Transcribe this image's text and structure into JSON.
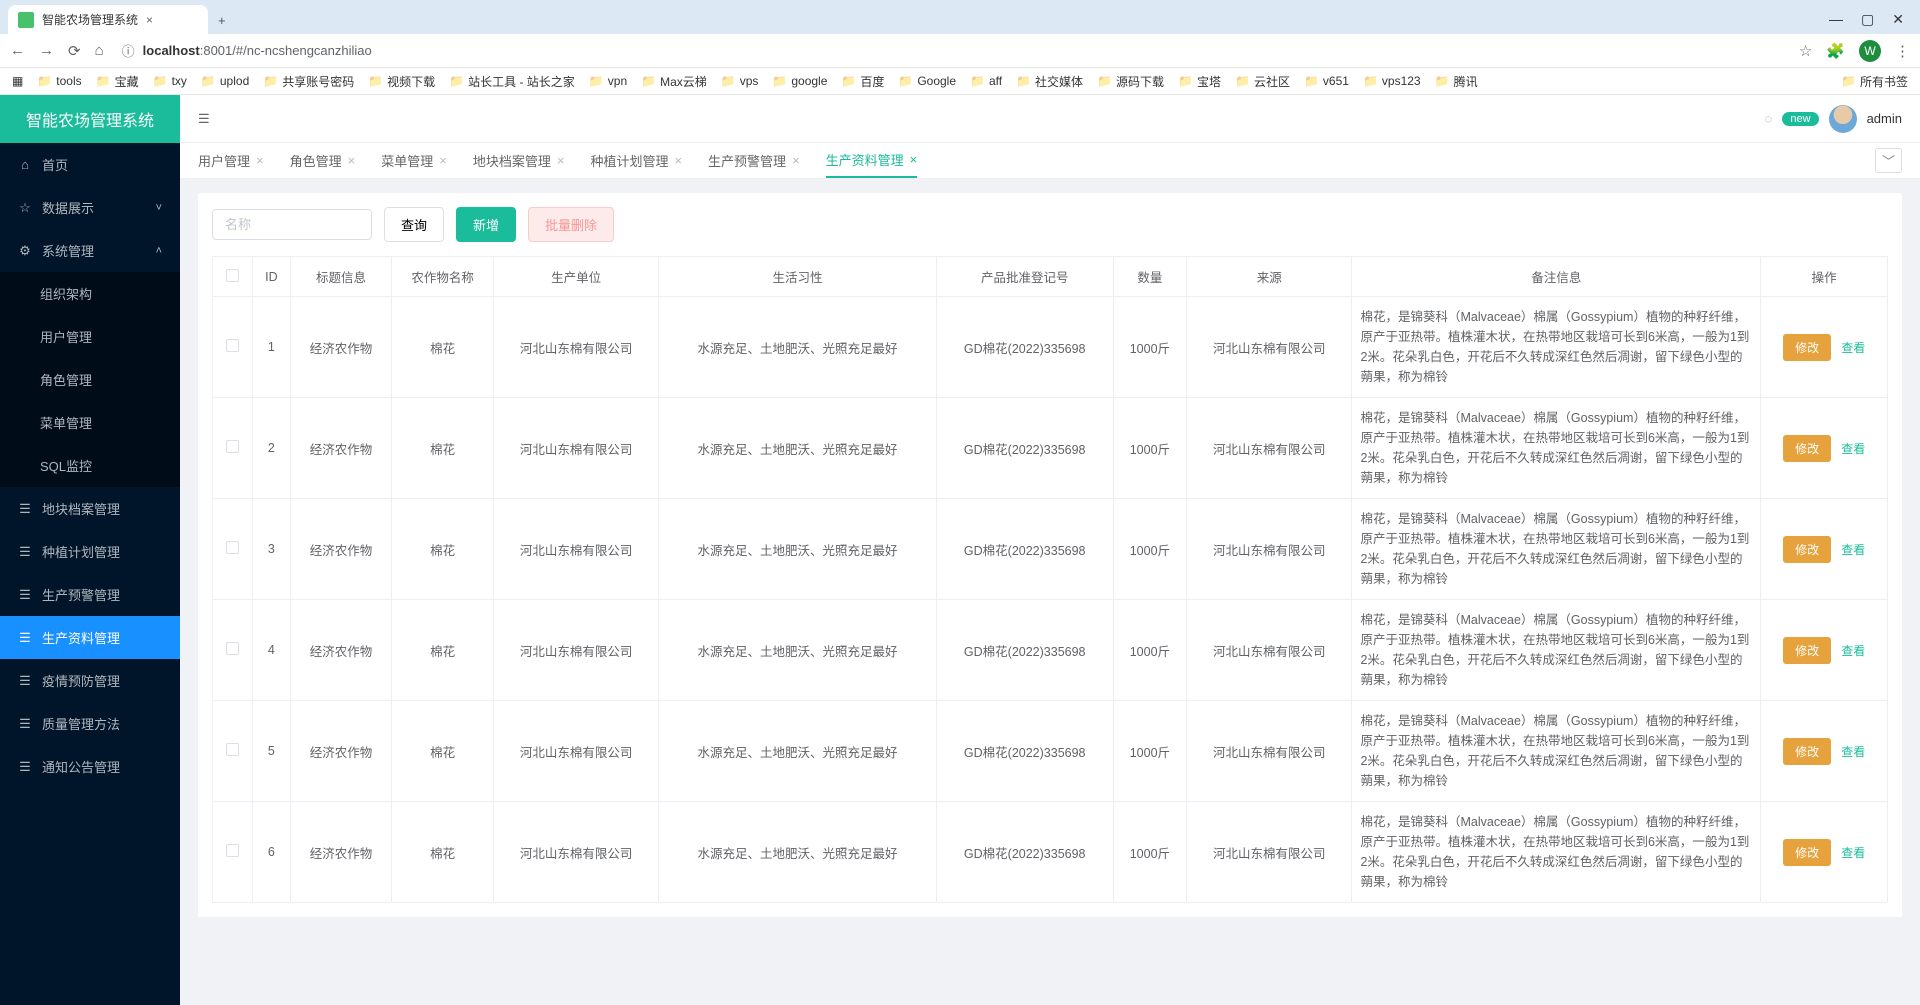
{
  "browser": {
    "tab_title": "智能农场管理系统",
    "new_tab": "+",
    "win_min": "—",
    "win_max": "▢",
    "win_close": "✕",
    "url_host": "localhost",
    "url_rest": ":8001/#/nc-ncshengcanzhiliao",
    "avatar_letter": "W",
    "bookmarks": [
      "tools",
      "宝藏",
      "txy",
      "uplod",
      "共享账号密码",
      "视频下载",
      "站长工具 - 站长之家",
      "vpn",
      "Max云梯",
      "vps",
      "google",
      "百度",
      "Google",
      "aff",
      "社交媒体",
      "源码下载",
      "宝塔",
      "云社区",
      "v651",
      "vps123",
      "腾讯"
    ],
    "all_bm": "所有书签"
  },
  "app": {
    "logo": "智能农场管理系统",
    "username": "admin",
    "new_badge": "new"
  },
  "sidebar": [
    {
      "icon": "⌂",
      "label": "首页",
      "hasChildren": false
    },
    {
      "icon": "☆",
      "label": "数据展示",
      "hasChildren": true,
      "open": false
    },
    {
      "icon": "⚙",
      "label": "系统管理",
      "hasChildren": true,
      "open": true,
      "children": [
        {
          "icon": "",
          "label": "组织架构"
        },
        {
          "icon": "",
          "label": "用户管理"
        },
        {
          "icon": "",
          "label": "角色管理"
        },
        {
          "icon": "",
          "label": "菜单管理"
        },
        {
          "icon": "",
          "label": "SQL监控"
        }
      ]
    },
    {
      "icon": "☰",
      "label": "地块档案管理",
      "hasChildren": false
    },
    {
      "icon": "☰",
      "label": "种植计划管理",
      "hasChildren": false
    },
    {
      "icon": "☰",
      "label": "生产预警管理",
      "hasChildren": false
    },
    {
      "icon": "☰",
      "label": "生产资料管理",
      "hasChildren": false,
      "active": true
    },
    {
      "icon": "☰",
      "label": "疫情预防管理",
      "hasChildren": false
    },
    {
      "icon": "☰",
      "label": "质量管理方法",
      "hasChildren": false
    },
    {
      "icon": "☰",
      "label": "通知公告管理",
      "hasChildren": false
    }
  ],
  "tabs": [
    {
      "label": "用户管理",
      "active": false
    },
    {
      "label": "角色管理",
      "active": false
    },
    {
      "label": "菜单管理",
      "active": false
    },
    {
      "label": "地块档案管理",
      "active": false
    },
    {
      "label": "种植计划管理",
      "active": false
    },
    {
      "label": "生产预警管理",
      "active": false
    },
    {
      "label": "生产资料管理",
      "active": true
    }
  ],
  "filters": {
    "name_placeholder": "名称",
    "search": "查询",
    "add": "新增",
    "batch_delete": "批量删除"
  },
  "table": {
    "headers": [
      "",
      "ID",
      "标题信息",
      "农作物名称",
      "生产单位",
      "生活习性",
      "产品批准登记号",
      "数量",
      "来源",
      "备注信息",
      "操作"
    ],
    "edit": "修改",
    "view": "查看",
    "rows": [
      {
        "id": "1",
        "title": "经济农作物",
        "crop": "棉花",
        "unit": "河北山东棉有限公司",
        "habit": "水源充足、土地肥沃、光照充足最好",
        "reg": "GD棉花(2022)335698",
        "qty": "1000斤",
        "source": "河北山东棉有限公司",
        "remark": "棉花，是锦葵科（Malvaceae）棉属（Gossypium）植物的种籽纤维，原产于亚热带。植株灌木状，在热带地区栽培可长到6米高，一般为1到2米。花朵乳白色，开花后不久转成深红色然后凋谢，留下绿色小型的蒴果，称为棉铃"
      },
      {
        "id": "2",
        "title": "经济农作物",
        "crop": "棉花",
        "unit": "河北山东棉有限公司",
        "habit": "水源充足、土地肥沃、光照充足最好",
        "reg": "GD棉花(2022)335698",
        "qty": "1000斤",
        "source": "河北山东棉有限公司",
        "remark": "棉花，是锦葵科（Malvaceae）棉属（Gossypium）植物的种籽纤维，原产于亚热带。植株灌木状，在热带地区栽培可长到6米高，一般为1到2米。花朵乳白色，开花后不久转成深红色然后凋谢，留下绿色小型的蒴果，称为棉铃"
      },
      {
        "id": "3",
        "title": "经济农作物",
        "crop": "棉花",
        "unit": "河北山东棉有限公司",
        "habit": "水源充足、土地肥沃、光照充足最好",
        "reg": "GD棉花(2022)335698",
        "qty": "1000斤",
        "source": "河北山东棉有限公司",
        "remark": "棉花，是锦葵科（Malvaceae）棉属（Gossypium）植物的种籽纤维，原产于亚热带。植株灌木状，在热带地区栽培可长到6米高，一般为1到2米。花朵乳白色，开花后不久转成深红色然后凋谢，留下绿色小型的蒴果，称为棉铃"
      },
      {
        "id": "4",
        "title": "经济农作物",
        "crop": "棉花",
        "unit": "河北山东棉有限公司",
        "habit": "水源充足、土地肥沃、光照充足最好",
        "reg": "GD棉花(2022)335698",
        "qty": "1000斤",
        "source": "河北山东棉有限公司",
        "remark": "棉花，是锦葵科（Malvaceae）棉属（Gossypium）植物的种籽纤维，原产于亚热带。植株灌木状，在热带地区栽培可长到6米高，一般为1到2米。花朵乳白色，开花后不久转成深红色然后凋谢，留下绿色小型的蒴果，称为棉铃"
      },
      {
        "id": "5",
        "title": "经济农作物",
        "crop": "棉花",
        "unit": "河北山东棉有限公司",
        "habit": "水源充足、土地肥沃、光照充足最好",
        "reg": "GD棉花(2022)335698",
        "qty": "1000斤",
        "source": "河北山东棉有限公司",
        "remark": "棉花，是锦葵科（Malvaceae）棉属（Gossypium）植物的种籽纤维，原产于亚热带。植株灌木状，在热带地区栽培可长到6米高，一般为1到2米。花朵乳白色，开花后不久转成深红色然后凋谢，留下绿色小型的蒴果，称为棉铃"
      },
      {
        "id": "6",
        "title": "经济农作物",
        "crop": "棉花",
        "unit": "河北山东棉有限公司",
        "habit": "水源充足、土地肥沃、光照充足最好",
        "reg": "GD棉花(2022)335698",
        "qty": "1000斤",
        "source": "河北山东棉有限公司",
        "remark": "棉花，是锦葵科（Malvaceae）棉属（Gossypium）植物的种籽纤维，原产于亚热带。植株灌木状，在热带地区栽培可长到6米高，一般为1到2米。花朵乳白色，开花后不久转成深红色然后凋谢，留下绿色小型的蒴果，称为棉铃"
      }
    ]
  }
}
